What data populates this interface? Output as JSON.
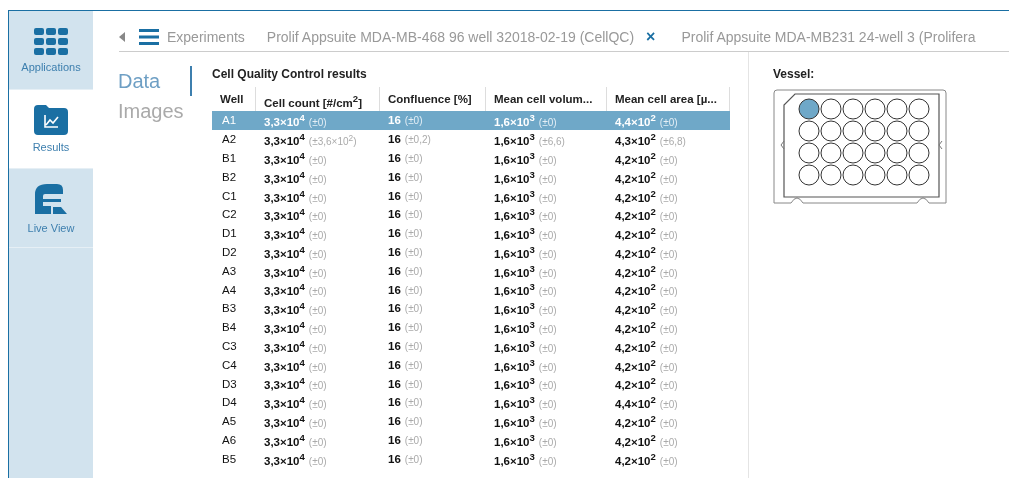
{
  "sidebar": {
    "items": [
      {
        "label": "Applications",
        "selected": false
      },
      {
        "label": "Results",
        "selected": true
      },
      {
        "label": "Live View",
        "selected": false
      }
    ]
  },
  "breadcrumb": {
    "menu_label": "Experiments",
    "tabs": [
      {
        "label": "Prolif Appsuite MDA-MB-468 96 well 32018-02-19 (CellQC)",
        "close": "×"
      },
      {
        "label": "Prolif Appsuite MDA-MB231 24-well 3 (Prolifera"
      }
    ]
  },
  "views": [
    {
      "label": "Data",
      "selected": true
    },
    {
      "label": "Images",
      "selected": false
    }
  ],
  "table": {
    "title": "Cell Quality Control results",
    "columns": [
      "Well",
      "Cell count [#/cm$^{2}$]",
      "Confluence [%]",
      "Mean cell volum...",
      "Mean cell area [µ..."
    ],
    "rows": [
      {
        "well": "A1",
        "selected": true,
        "values": [
          {
            "value": "3,3×10$^{4}$",
            "error": "(±0)"
          },
          {
            "value": "16",
            "error": "(±0)"
          },
          {
            "value": "1,6×10$^{3}$",
            "error": "(±0)"
          },
          {
            "value": "4,4×10$^{2}$",
            "error": "(±0)"
          }
        ]
      },
      {
        "well": "A2",
        "selected": false,
        "values": [
          {
            "value": "3,3×10$^{4}$",
            "error": "(±3,6×10$^{2}$)"
          },
          {
            "value": "16",
            "error": "(±0,2)"
          },
          {
            "value": "1,6×10$^{3}$",
            "error": "(±6,6)"
          },
          {
            "value": "4,3×10$^{2}$",
            "error": "(±6,8)"
          }
        ]
      },
      {
        "well": "B1",
        "selected": false,
        "values": [
          {
            "value": "3,3×10$^{4}$",
            "error": "(±0)"
          },
          {
            "value": "16",
            "error": "(±0)"
          },
          {
            "value": "1,6×10$^{3}$",
            "error": "(±0)"
          },
          {
            "value": "4,2×10$^{2}$",
            "error": "(±0)"
          }
        ]
      },
      {
        "well": "B2",
        "selected": false,
        "values": [
          {
            "value": "3,3×10$^{4}$",
            "error": "(±0)"
          },
          {
            "value": "16",
            "error": "(±0)"
          },
          {
            "value": "1,6×10$^{3}$",
            "error": "(±0)"
          },
          {
            "value": "4,2×10$^{2}$",
            "error": "(±0)"
          }
        ]
      },
      {
        "well": "C1",
        "selected": false,
        "values": [
          {
            "value": "3,3×10$^{4}$",
            "error": "(±0)"
          },
          {
            "value": "16",
            "error": "(±0)"
          },
          {
            "value": "1,6×10$^{3}$",
            "error": "(±0)"
          },
          {
            "value": "4,2×10$^{2}$",
            "error": "(±0)"
          }
        ]
      },
      {
        "well": "C2",
        "selected": false,
        "values": [
          {
            "value": "3,3×10$^{4}$",
            "error": "(±0)"
          },
          {
            "value": "16",
            "error": "(±0)"
          },
          {
            "value": "1,6×10$^{3}$",
            "error": "(±0)"
          },
          {
            "value": "4,2×10$^{2}$",
            "error": "(±0)"
          }
        ]
      },
      {
        "well": "D1",
        "selected": false,
        "values": [
          {
            "value": "3,3×10$^{4}$",
            "error": "(±0)"
          },
          {
            "value": "16",
            "error": "(±0)"
          },
          {
            "value": "1,6×10$^{3}$",
            "error": "(±0)"
          },
          {
            "value": "4,2×10$^{2}$",
            "error": "(±0)"
          }
        ]
      },
      {
        "well": "D2",
        "selected": false,
        "values": [
          {
            "value": "3,3×10$^{4}$",
            "error": "(±0)"
          },
          {
            "value": "16",
            "error": "(±0)"
          },
          {
            "value": "1,6×10$^{3}$",
            "error": "(±0)"
          },
          {
            "value": "4,2×10$^{2}$",
            "error": "(±0)"
          }
        ]
      },
      {
        "well": "A3",
        "selected": false,
        "values": [
          {
            "value": "3,3×10$^{4}$",
            "error": "(±0)"
          },
          {
            "value": "16",
            "error": "(±0)"
          },
          {
            "value": "1,6×10$^{3}$",
            "error": "(±0)"
          },
          {
            "value": "4,2×10$^{2}$",
            "error": "(±0)"
          }
        ]
      },
      {
        "well": "A4",
        "selected": false,
        "values": [
          {
            "value": "3,3×10$^{4}$",
            "error": "(±0)"
          },
          {
            "value": "16",
            "error": "(±0)"
          },
          {
            "value": "1,6×10$^{3}$",
            "error": "(±0)"
          },
          {
            "value": "4,2×10$^{2}$",
            "error": "(±0)"
          }
        ]
      },
      {
        "well": "B3",
        "selected": false,
        "values": [
          {
            "value": "3,3×10$^{4}$",
            "error": "(±0)"
          },
          {
            "value": "16",
            "error": "(±0)"
          },
          {
            "value": "1,6×10$^{3}$",
            "error": "(±0)"
          },
          {
            "value": "4,2×10$^{2}$",
            "error": "(±0)"
          }
        ]
      },
      {
        "well": "B4",
        "selected": false,
        "values": [
          {
            "value": "3,3×10$^{4}$",
            "error": "(±0)"
          },
          {
            "value": "16",
            "error": "(±0)"
          },
          {
            "value": "1,6×10$^{3}$",
            "error": "(±0)"
          },
          {
            "value": "4,2×10$^{2}$",
            "error": "(±0)"
          }
        ]
      },
      {
        "well": "C3",
        "selected": false,
        "values": [
          {
            "value": "3,3×10$^{4}$",
            "error": "(±0)"
          },
          {
            "value": "16",
            "error": "(±0)"
          },
          {
            "value": "1,6×10$^{3}$",
            "error": "(±0)"
          },
          {
            "value": "4,2×10$^{2}$",
            "error": "(±0)"
          }
        ]
      },
      {
        "well": "C4",
        "selected": false,
        "values": [
          {
            "value": "3,3×10$^{4}$",
            "error": "(±0)"
          },
          {
            "value": "16",
            "error": "(±0)"
          },
          {
            "value": "1,6×10$^{3}$",
            "error": "(±0)"
          },
          {
            "value": "4,2×10$^{2}$",
            "error": "(±0)"
          }
        ]
      },
      {
        "well": "D3",
        "selected": false,
        "values": [
          {
            "value": "3,3×10$^{4}$",
            "error": "(±0)"
          },
          {
            "value": "16",
            "error": "(±0)"
          },
          {
            "value": "1,6×10$^{3}$",
            "error": "(±0)"
          },
          {
            "value": "4,2×10$^{2}$",
            "error": "(±0)"
          }
        ]
      },
      {
        "well": "D4",
        "selected": false,
        "values": [
          {
            "value": "3,3×10$^{4}$",
            "error": "(±0)"
          },
          {
            "value": "16",
            "error": "(±0)"
          },
          {
            "value": "1,6×10$^{3}$",
            "error": "(±0)"
          },
          {
            "value": "4,4×10$^{2}$",
            "error": "(±0)"
          }
        ]
      },
      {
        "well": "A5",
        "selected": false,
        "values": [
          {
            "value": "3,3×10$^{4}$",
            "error": "(±0)"
          },
          {
            "value": "16",
            "error": "(±0)"
          },
          {
            "value": "1,6×10$^{3}$",
            "error": "(±0)"
          },
          {
            "value": "4,2×10$^{2}$",
            "error": "(±0)"
          }
        ]
      },
      {
        "well": "A6",
        "selected": false,
        "values": [
          {
            "value": "3,3×10$^{4}$",
            "error": "(±0)"
          },
          {
            "value": "16",
            "error": "(±0)"
          },
          {
            "value": "1,6×10$^{3}$",
            "error": "(±0)"
          },
          {
            "value": "4,2×10$^{2}$",
            "error": "(±0)"
          }
        ]
      },
      {
        "well": "B5",
        "selected": false,
        "values": [
          {
            "value": "3,3×10$^{4}$",
            "error": "(±0)"
          },
          {
            "value": "16",
            "error": "(±0)"
          },
          {
            "value": "1,6×10$^{3}$",
            "error": "(±0)"
          },
          {
            "value": "4,2×10$^{2}$",
            "error": "(±0)"
          }
        ]
      }
    ]
  },
  "vessel": {
    "label": "Vessel:",
    "wells": [
      {
        "selected": true
      },
      {
        "selected": false
      },
      {
        "selected": false
      },
      {
        "selected": false
      },
      {
        "selected": false
      },
      {
        "selected": false
      },
      {
        "selected": false
      },
      {
        "selected": false
      },
      {
        "selected": false
      },
      {
        "selected": false
      },
      {
        "selected": false
      },
      {
        "selected": false
      },
      {
        "selected": false
      },
      {
        "selected": false
      },
      {
        "selected": false
      },
      {
        "selected": false
      },
      {
        "selected": false
      },
      {
        "selected": false
      },
      {
        "selected": false
      },
      {
        "selected": false
      },
      {
        "selected": false
      },
      {
        "selected": false
      },
      {
        "selected": false
      },
      {
        "selected": false
      }
    ]
  }
}
